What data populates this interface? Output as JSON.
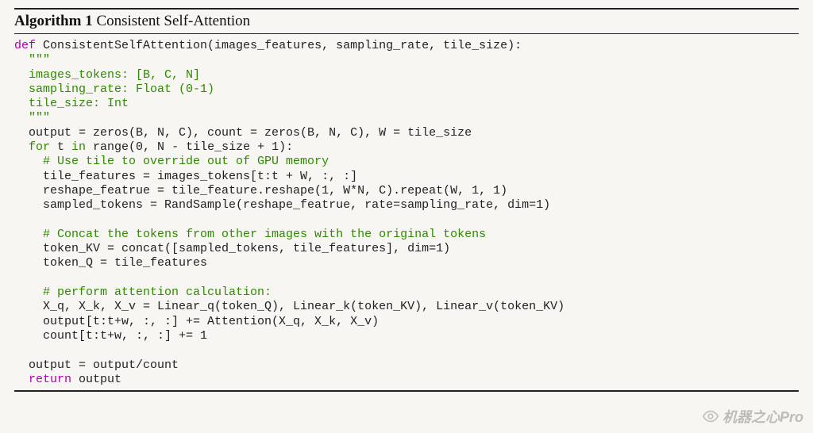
{
  "algo": {
    "label_prefix": "Algorithm 1",
    "title": " Consistent Self-Attention"
  },
  "code": {
    "def_kw": "def",
    "fn_sig": " ConsistentSelfAttention(images_features, sampling_rate, tile_size):",
    "doc_q1": "  \"\"\"",
    "doc_l1": "  images_tokens: [B, C, N]",
    "doc_l2": "  sampling_rate: Float (0-1)",
    "doc_l3": "  tile_size: Int",
    "doc_q2": "  \"\"\"",
    "l_init": "  output = zeros(B, N, C), count = zeros(B, N, C), W = tile_size",
    "for_kw": "  for",
    "for_var": " t ",
    "in_kw": "in",
    "for_rest": " range(0, N - tile_size + 1):",
    "c_tile": "    # Use tile to override out of GPU memory",
    "l_tile1": "    tile_features = images_tokens[t:t + W, :, :]",
    "l_tile2": "    reshape_featrue = tile_feature.reshape(1, W*N, C).repeat(W, 1, 1)",
    "l_tile3": "    sampled_tokens = RandSample(reshape_featrue, rate=sampling_rate, dim=1)",
    "blank1": "",
    "c_concat": "    # Concat the tokens from other images with the original tokens",
    "l_kv": "    token_KV = concat([sampled_tokens, tile_features], dim=1)",
    "l_q": "    token_Q = tile_features",
    "blank2": "",
    "c_attn": "    # perform attention calculation:",
    "l_lin": "    X_q, X_k, X_v = Linear_q(token_Q), Linear_k(token_KV), Linear_v(token_KV)",
    "l_out": "    output[t:t+w, :, :] += Attention(X_q, X_k, X_v)",
    "l_cnt": "    count[t:t+w, :, :] += 1",
    "blank3": "",
    "l_div": "  output = output/count",
    "ret_kw": "  return",
    "ret_rest": " output"
  },
  "watermark": {
    "text": "机器之心Pro"
  }
}
